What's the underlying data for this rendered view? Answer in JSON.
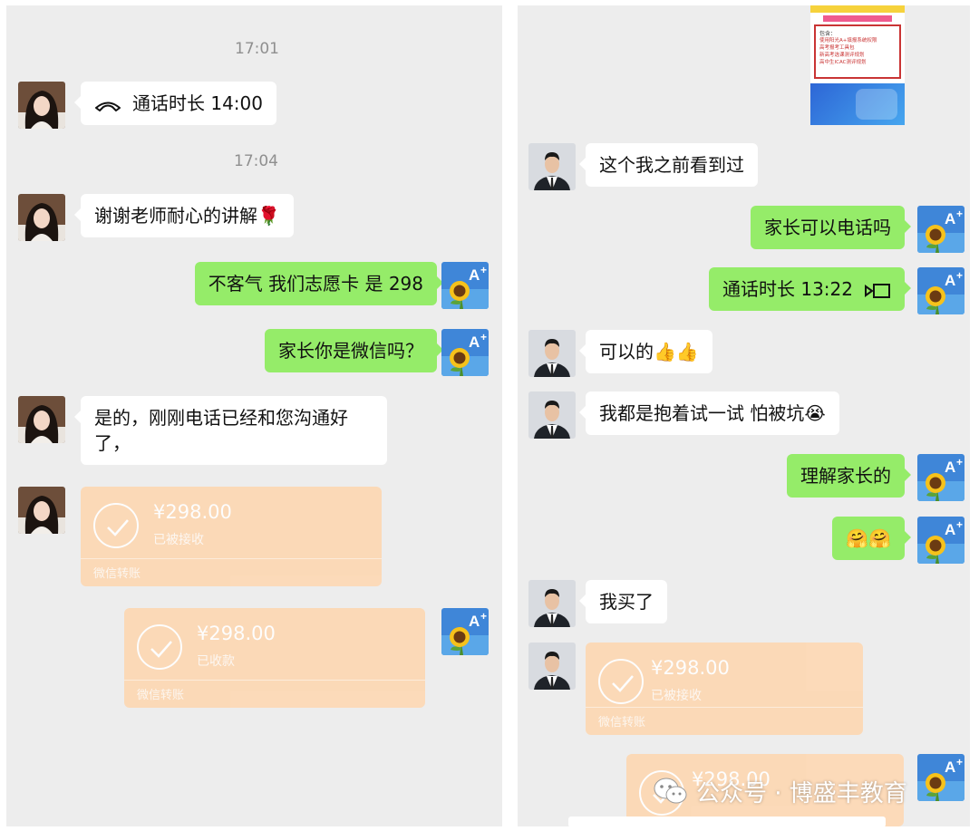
{
  "left_chat": {
    "time_1": "17:01",
    "call": {
      "label": "通话时长 14:00",
      "icon": "phone-handset-icon"
    },
    "time_2": "17:04",
    "messages": [
      {
        "side": "in",
        "text": "谢谢老师耐心的讲解🌹"
      },
      {
        "side": "out",
        "text": "不客气 我们志愿卡 是 298"
      },
      {
        "side": "out",
        "text": "家长你是微信吗？"
      },
      {
        "side": "in",
        "text": "是的，刚刚电话已经和您沟通好了，"
      }
    ],
    "transfers": [
      {
        "amount": "¥298.00",
        "status": "已被接收",
        "footer": "微信转账"
      },
      {
        "amount": "¥298.00",
        "status": "已收款",
        "footer": "微信转账"
      }
    ]
  },
  "right_chat": {
    "poster": {
      "header": "包含：",
      "lines": [
        "使用阳光A+填报系统权限",
        "高考报考工具包",
        "新高考选课测评规划",
        "高中生ICAC测评规划"
      ]
    },
    "messages": [
      {
        "side": "in",
        "text": "这个我之前看到过"
      },
      {
        "side": "out",
        "text": "家长可以电话吗"
      },
      {
        "side": "out",
        "text": "通话时长 13:22",
        "icon": "video-call-icon"
      },
      {
        "side": "in",
        "text": "可以的👍👍"
      },
      {
        "side": "in",
        "text": "我都是抱着试一试 怕被坑😭"
      },
      {
        "side": "out",
        "text": "理解家长的"
      },
      {
        "side": "out",
        "text": "🤗🤗"
      },
      {
        "side": "in",
        "text": "我买了"
      }
    ],
    "transfers": [
      {
        "amount": "¥298.00",
        "status": "已被接收",
        "footer": "微信转账"
      },
      {
        "amount": "¥298.00",
        "status": "",
        "footer": ""
      }
    ]
  },
  "avatars": {
    "parent": "woman-portrait-avatar",
    "teacher": "sunflower-a-plus-avatar",
    "customer": "man-in-suit-avatar"
  },
  "watermark": {
    "text": "公众号 · 博盛丰教育",
    "icon": "wechat-logo-icon"
  },
  "colors": {
    "sent_bubble": "#95ec69",
    "received_bubble": "#ffffff",
    "transfer": "#fdd7b2",
    "background": "#ededed"
  }
}
